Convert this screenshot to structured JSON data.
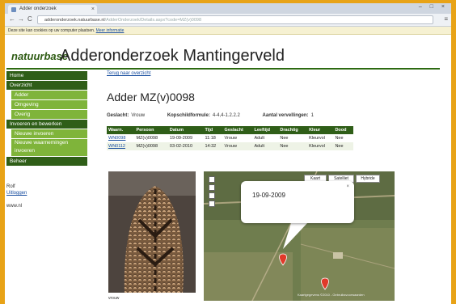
{
  "browser": {
    "tab_title": "Adder onderzoek",
    "tab_close": "×",
    "window_controls": "– □ ×",
    "back": "←",
    "forward": "→",
    "reload": "C",
    "url_host": "adderonderzoek.natuurbase.nl",
    "url_path": "/AdderOnderzoek/Details.aspx?code=MZ(v)0098",
    "menu": "≡",
    "info_text": "Deze site kan cookies op uw computer plaatsen. ",
    "info_link": "Meer informatie"
  },
  "site": {
    "logo": "natuurbase",
    "title": "Adderonderzoek Mantingerveld"
  },
  "sidebar": {
    "items": [
      {
        "label": "Home",
        "style": "dark"
      },
      {
        "label": "Overzicht",
        "style": "dark"
      },
      {
        "label": "Adder",
        "style": "light"
      },
      {
        "label": "Omgeving",
        "style": "light"
      },
      {
        "label": "Overig",
        "style": "light"
      },
      {
        "label": "Invoeren en bewerken",
        "style": "dark"
      },
      {
        "label": "Nieuwe invoeren",
        "style": "light"
      },
      {
        "label": "Nieuwe waarnemingen invoeren",
        "style": "light"
      },
      {
        "label": "Beheer",
        "style": "dark"
      }
    ],
    "user": "Rolf",
    "logout": "Uitloggen",
    "footer_url": "www.nl"
  },
  "main": {
    "back_link": "Terug naar overzicht",
    "adder_title": "Adder MZ(v)0098",
    "meta": {
      "sex_label": "Geslacht:",
      "sex_value": "Vrouw",
      "head_label": "Kopschildformule:",
      "head_value": "4-4,4-1.2.2.2",
      "moult_label": "Aantal vervellingen:",
      "moult_value": "1"
    },
    "table": {
      "headers": [
        "Waarn.",
        "Persoon",
        "Datum",
        "Tijd",
        "Geslacht",
        "Leeftijd",
        "Drachtig",
        "Kleur",
        "Dood"
      ],
      "rows": [
        [
          "WN0098",
          "MZ(v)0098",
          "19-09-2009",
          "11:18",
          "Vrouw",
          "Adult",
          "Nee",
          "Kleurvol",
          "Nee"
        ],
        [
          "WN0112",
          "MZ(v)0098",
          "03-02-2010",
          "14:32",
          "Vrouw",
          "Adult",
          "Nee",
          "Kleurvol",
          "Nee"
        ]
      ]
    },
    "photo_caption": "vrouw",
    "map": {
      "btn_map": "Kaart",
      "btn_sat": "Satelliet",
      "btn_hybrid": "Hybride",
      "popup_date": "19-09-2009",
      "popup_close": "×",
      "copyright": "Kaartgegevens ©2010 - Gebruiksvoorwaarden"
    }
  },
  "colors": {
    "frame_border": "#e8a317",
    "nav_dark": "#2f5e18",
    "nav_light": "#7fb43a",
    "link": "#1a4fa0",
    "marker": "#e03a2a"
  }
}
